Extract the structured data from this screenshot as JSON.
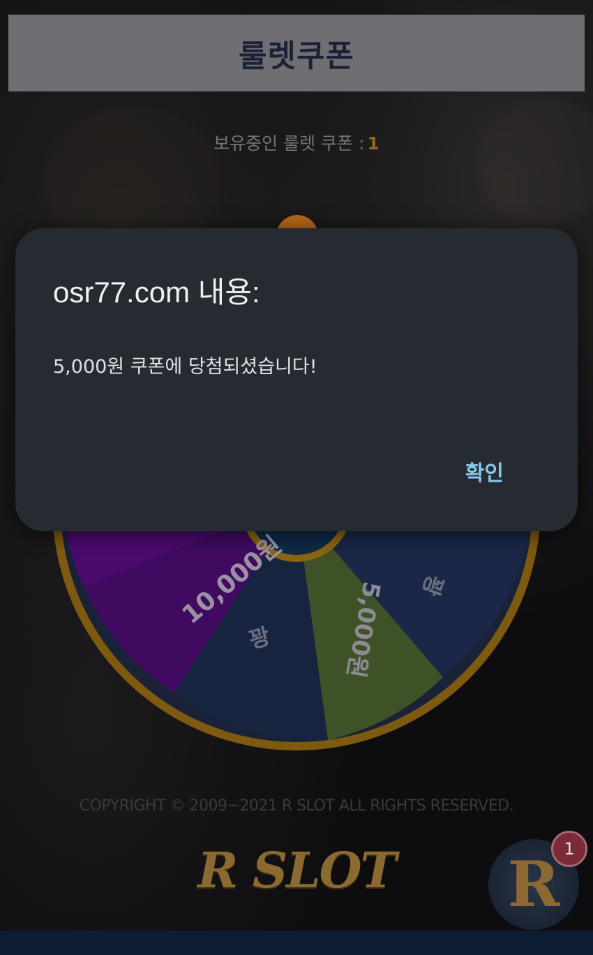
{
  "header": {
    "title": "룰렛쿠폰"
  },
  "coupon_status": {
    "label": "보유중인 룰렛 쿠폰 :",
    "count": "1"
  },
  "wheel": {
    "segments": [
      {
        "label": "10,000원",
        "color": "#5a0b86"
      },
      {
        "label": "꽝",
        "color": "#172440"
      },
      {
        "label": "5,000원",
        "color": "#3f5227"
      },
      {
        "label": "꽝",
        "color": "#1a2746"
      }
    ],
    "rim_color": "#8a6411"
  },
  "dialog": {
    "title": "osr77.com 내용:",
    "message": "5,000원 쿠폰에 당첨되셨습니다!",
    "ok_label": "확인"
  },
  "footer": {
    "copyright": "COPYRIGHT © 2009~2021 R SLOT ALL RIGHTS RESERVED.",
    "logo_text": "R SLOT"
  },
  "floating_button": {
    "letter": "R",
    "badge_count": "1"
  }
}
